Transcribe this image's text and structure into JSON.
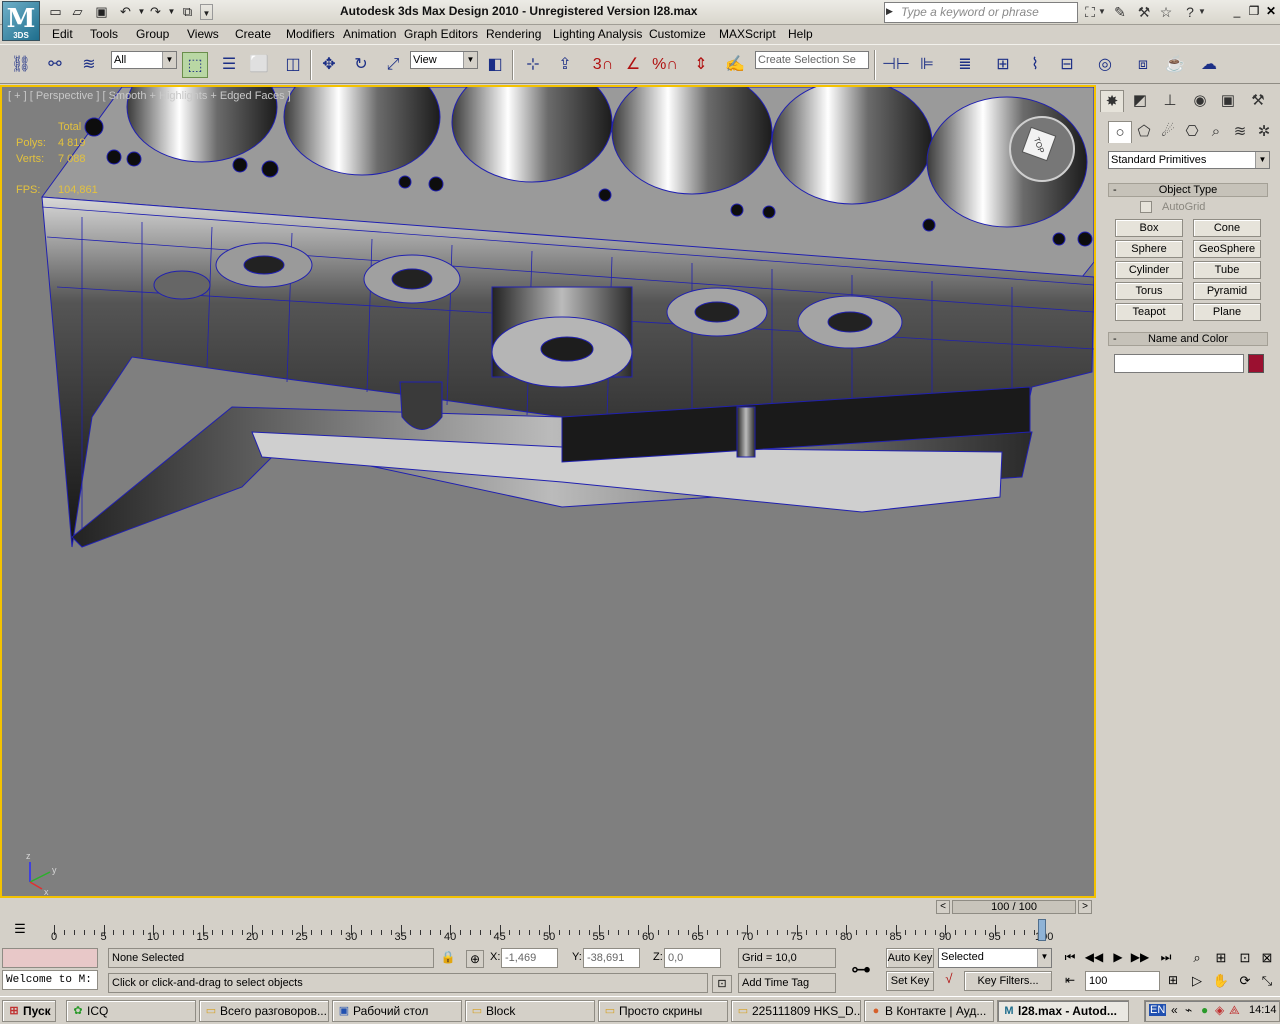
{
  "titlebar": {
    "title": "Autodesk 3ds Max Design 2010  - Unregistered Version    l28.max",
    "logo_label": "3DS",
    "logo_glyph": "M",
    "search_placeholder": "Type a keyword or phrase"
  },
  "menu": [
    "Edit",
    "Tools",
    "Group",
    "Views",
    "Create",
    "Modifiers",
    "Animation",
    "Graph Editors",
    "Rendering",
    "Lighting Analysis",
    "Customize",
    "MAXScript",
    "Help"
  ],
  "toolbar": {
    "selection_filter": "All",
    "reference_coord": "View",
    "selection_set_placeholder": "Create Selection Se",
    "snap_labels": [
      "3",
      "%"
    ]
  },
  "viewport": {
    "label": "[ + ] [ Perspective ] [ Smooth + Highlights + Edged Faces ]",
    "stats": {
      "total_label": "Total",
      "polys_label": "Polys:",
      "polys_value": "4 819",
      "verts_label": "Verts:",
      "verts_value": "7 088",
      "fps_label": "FPS:",
      "fps_value": "104,861"
    },
    "viewcube_label": "TOP",
    "axis": {
      "z": "z",
      "y": "y",
      "x": "x"
    }
  },
  "command_panel": {
    "category": "Standard Primitives",
    "object_type_header": "Object Type",
    "autogrid_label": "AutoGrid",
    "primitives": [
      "Box",
      "Cone",
      "Sphere",
      "GeoSphere",
      "Cylinder",
      "Tube",
      "Torus",
      "Pyramid",
      "Teapot",
      "Plane"
    ],
    "name_color_header": "Name and Color",
    "object_color": "#9b1030"
  },
  "timeline": {
    "frame_readout": "100 / 100",
    "ticks": [
      "0",
      "5",
      "10",
      "15",
      "20",
      "25",
      "30",
      "35",
      "40",
      "45",
      "50",
      "55",
      "60",
      "65",
      "70",
      "75",
      "80",
      "85",
      "90",
      "95",
      "100"
    ]
  },
  "status": {
    "maxscript_text": "Welcome to M:",
    "selection_text": "None Selected",
    "prompt_text": "Click or click-and-drag to select objects",
    "x_label": "X:",
    "x_value": "-1,469",
    "y_label": "Y:",
    "y_value": "-38,691",
    "z_label": "Z:",
    "z_value": "0,0",
    "grid_text": "Grid = 10,0",
    "add_time_tag": "Add Time Tag",
    "auto_key": "Auto Key",
    "set_key": "Set Key",
    "key_mode": "Selected",
    "key_filters": "Key Filters...",
    "current_frame": "100"
  },
  "taskbar": {
    "start_label": "Пуск",
    "tasks": [
      "ICQ",
      "Всего разговоров...",
      "Рабочий стол",
      "Block",
      "Просто скрины",
      "225111809 HKS_D...",
      "В Контакте | Ауд...",
      "l28.max - Autod..."
    ],
    "language": "EN",
    "clock": "14:14"
  },
  "colors": {
    "viewport_bg": "#7f7f7f",
    "viewport_border": "#f3c200",
    "stats_text": "#e3c23e",
    "wire": "#2020b0"
  }
}
